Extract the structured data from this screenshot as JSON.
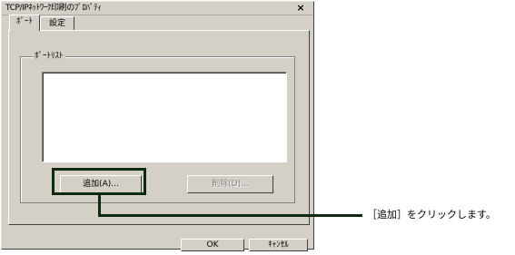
{
  "window": {
    "title": "TCP/IPﾈｯﾄﾜｰｸ印刷のﾌﾟﾛﾊﾟﾃｨ",
    "close_icon": "close-icon"
  },
  "tabs": [
    {
      "label": "ﾎﾟｰﾄ",
      "active": true
    },
    {
      "label": "設定",
      "active": false
    }
  ],
  "port_group": {
    "label": "ﾎﾟｰﾄﾘｽﾄ",
    "list_items": []
  },
  "buttons": {
    "add": "追加(A)...",
    "delete": "削除(D)...",
    "ok": "OK",
    "cancel": "ｷｬﾝｾﾙ"
  },
  "annotation": {
    "text": "［追加］をクリックします。"
  }
}
